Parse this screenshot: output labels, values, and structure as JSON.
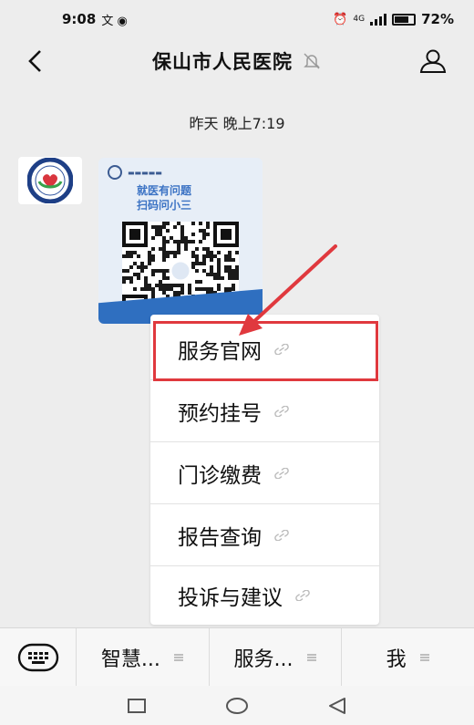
{
  "status_bar": {
    "time": "9:08",
    "network": "4G",
    "battery": "72%"
  },
  "header": {
    "title": "保山市人民医院"
  },
  "chat": {
    "timestamp": "昨天 晚上7:19",
    "qr_card": {
      "slogan_line1": "就医有问题",
      "slogan_line2": "扫码问小三"
    }
  },
  "service_menu": {
    "items": [
      {
        "label": "服务官网"
      },
      {
        "label": "预约挂号"
      },
      {
        "label": "门诊缴费"
      },
      {
        "label": "报告查询"
      },
      {
        "label": "投诉与建议"
      }
    ]
  },
  "bottom_menu": {
    "tabs": [
      {
        "label": "智慧..."
      },
      {
        "label": "服务..."
      },
      {
        "label": "我"
      }
    ]
  },
  "colors": {
    "background": "#ededed",
    "highlight": "#e0393e",
    "card_blue": "#2f6fc0",
    "card_bg": "#e7eef7"
  },
  "icons": [
    "back-arrow-icon",
    "mute-bell-icon",
    "user-profile-icon",
    "link-icon",
    "keyboard-icon",
    "menu-lines-icon",
    "square-nav-icon",
    "circle-nav-icon",
    "triangle-back-icon",
    "alarm-icon",
    "signal-icon",
    "battery-icon"
  ]
}
